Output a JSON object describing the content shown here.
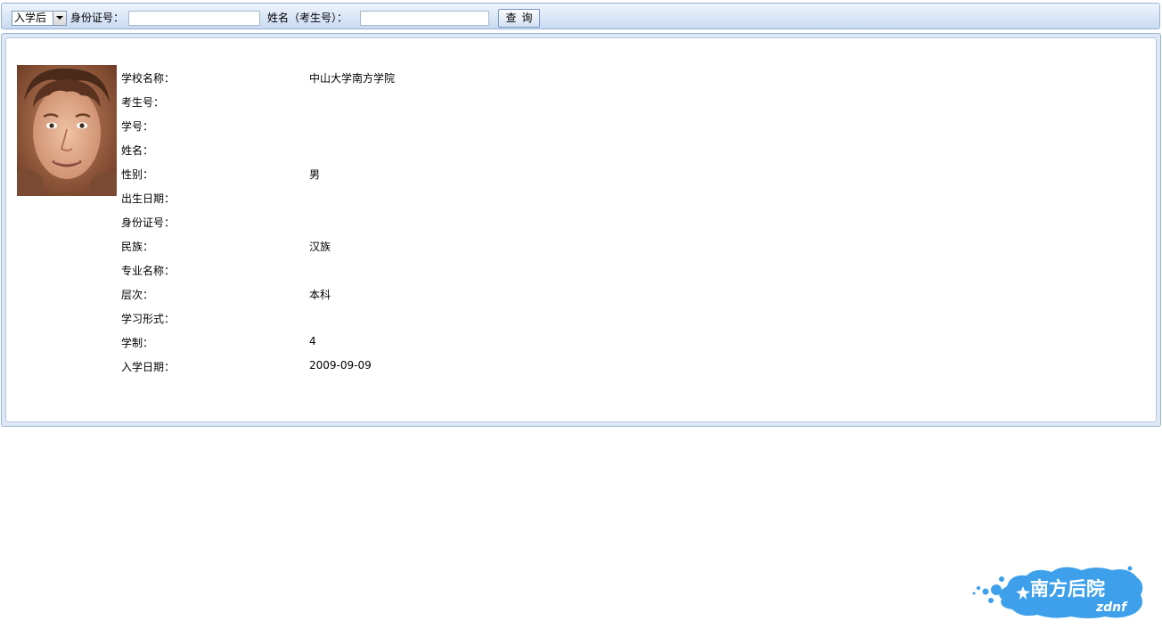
{
  "toolbar": {
    "stage_select": "入学后",
    "id_label": "身份证号：",
    "id_value": "",
    "name_label": "姓名（考生号）：",
    "name_value": "",
    "query_label": "查询"
  },
  "student": {
    "fields": [
      {
        "label": "学校名称：",
        "value": "中山大学南方学院"
      },
      {
        "label": "考生号：",
        "value": ""
      },
      {
        "label": "学号：",
        "value": ""
      },
      {
        "label": "姓名：",
        "value": ""
      },
      {
        "label": "性别：",
        "value": "男"
      },
      {
        "label": "出生日期：",
        "value": ""
      },
      {
        "label": "身份证号：",
        "value": ""
      },
      {
        "label": "民族：",
        "value": "汉族"
      },
      {
        "label": "专业名称：",
        "value": ""
      },
      {
        "label": "层次：",
        "value": "本科"
      },
      {
        "label": "学习形式：",
        "value": ""
      },
      {
        "label": "学制：",
        "value": "4"
      },
      {
        "label": "入学日期：",
        "value": "2009-09-09"
      }
    ]
  },
  "logo": {
    "text": "南方后院",
    "subtext": "zdnf",
    "color": "#3ea0ea"
  },
  "colors": {
    "toolbar_border": "#98b4d4",
    "panel_bg": "#dfe8f6"
  }
}
